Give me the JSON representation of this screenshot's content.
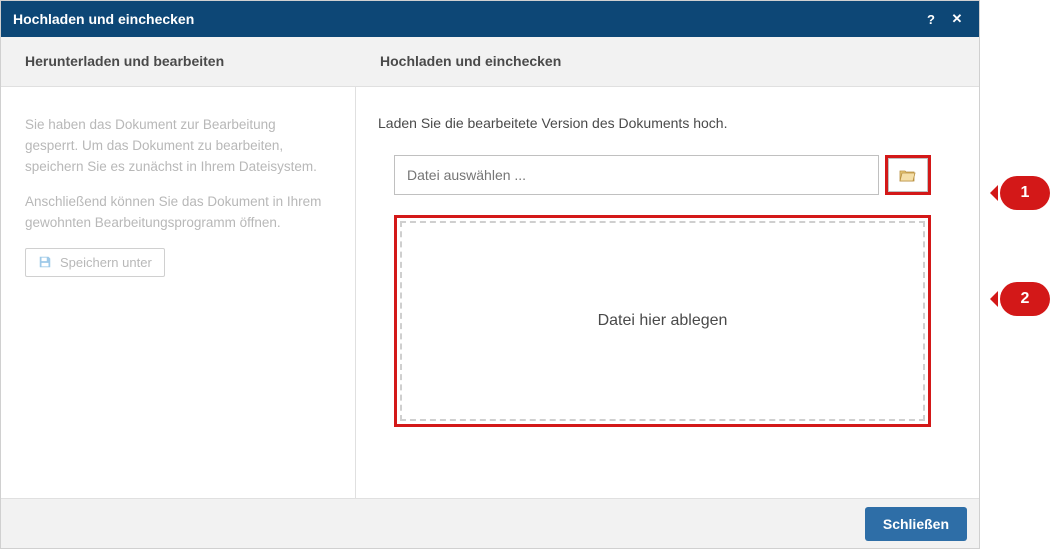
{
  "titlebar": {
    "title": "Hochladen und einchecken",
    "help_label": "?",
    "close_label": "✕"
  },
  "subheader": {
    "left": "Herunterladen und bearbeiten",
    "right": "Hochladen und einchecken"
  },
  "left_panel": {
    "info1": "Sie haben das Dokument zur Bearbeitung gesperrt. Um das Dokument zu bearbeiten, speichern Sie es zunächst in Ihrem Dateisystem.",
    "info2": "Anschließend können Sie das Dokument in Ihrem gewohnten Bearbeitungsprogramm öffnen.",
    "save_button": "Speichern unter"
  },
  "right_panel": {
    "instruction": "Laden Sie die bearbeitete Version des Dokuments hoch.",
    "file_placeholder": "Datei auswählen ...",
    "dropzone_text": "Datei hier ablegen"
  },
  "footer": {
    "close": "Schließen"
  },
  "callouts": {
    "one": "1",
    "two": "2"
  }
}
